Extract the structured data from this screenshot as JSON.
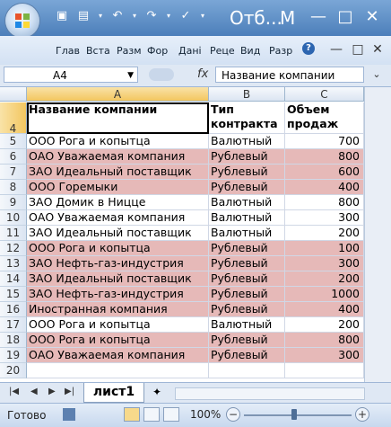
{
  "window": {
    "title": "Отб...",
    "title_extra": "M",
    "controls": [
      "—",
      "□",
      "✕"
    ],
    "quick_access": [
      "save-icon",
      "print-preview-icon",
      "undo-icon",
      "redo-icon",
      "check-icon"
    ]
  },
  "ribbon": {
    "tabs": [
      "Глав",
      "Вста",
      "Разм",
      "Фор",
      "Дані",
      "Реце",
      "Вид",
      "Разр"
    ],
    "help_label": "?"
  },
  "formula_bar": {
    "name_box": "A4",
    "fx_label": "fx",
    "content": "Название компании"
  },
  "columns": [
    "A",
    "B",
    "C"
  ],
  "header_row": {
    "row": "4",
    "cells": [
      "Название компании",
      "Тип контракта",
      "Объем продаж"
    ]
  },
  "rows": [
    {
      "row": "5",
      "company": "ООО Рога и копытца",
      "type": "Валютный",
      "volume": "700",
      "highlight": false
    },
    {
      "row": "6",
      "company": "ОАО Уважаемая компания",
      "type": "Рублевый",
      "volume": "800",
      "highlight": true
    },
    {
      "row": "7",
      "company": "ЗАО Идеальный поставщик",
      "type": "Рублевый",
      "volume": "600",
      "highlight": true
    },
    {
      "row": "8",
      "company": "ООО Горемыки",
      "type": "Рублевый",
      "volume": "400",
      "highlight": true
    },
    {
      "row": "9",
      "company": "ЗАО Домик в Ницце",
      "type": "Валютный",
      "volume": "800",
      "highlight": false
    },
    {
      "row": "10",
      "company": "ОАО Уважаемая компания",
      "type": "Валютный",
      "volume": "300",
      "highlight": false
    },
    {
      "row": "11",
      "company": "ЗАО Идеальный поставщик",
      "type": "Валютный",
      "volume": "200",
      "highlight": false
    },
    {
      "row": "12",
      "company": "ООО Рога и копытца",
      "type": "Рублевый",
      "volume": "100",
      "highlight": true
    },
    {
      "row": "13",
      "company": "ЗАО Нефть-газ-индустрия",
      "type": "Рублевый",
      "volume": "300",
      "highlight": true
    },
    {
      "row": "14",
      "company": "ЗАО Идеальный поставщик",
      "type": "Рублевый",
      "volume": "200",
      "highlight": true
    },
    {
      "row": "15",
      "company": "ЗАО Нефть-газ-индустрия",
      "type": "Рублевый",
      "volume": "1000",
      "highlight": true
    },
    {
      "row": "16",
      "company": "Иностранная компания",
      "type": "Рублевый",
      "volume": "400",
      "highlight": true
    },
    {
      "row": "17",
      "company": "ООО Рога и копытца",
      "type": "Валютный",
      "volume": "200",
      "highlight": false
    },
    {
      "row": "18",
      "company": "ООО Рога и копытца",
      "type": "Рублевый",
      "volume": "800",
      "highlight": true
    },
    {
      "row": "19",
      "company": "ОАО Уважаемая компания",
      "type": "Рублевый",
      "volume": "300",
      "highlight": true
    },
    {
      "row": "20",
      "company": "",
      "type": "",
      "volume": "",
      "highlight": false
    }
  ],
  "sheet_tabs": {
    "active": "лист1"
  },
  "status": {
    "text": "Готово",
    "zoom": "100%",
    "zoom_minus": "−",
    "zoom_plus": "+"
  },
  "colors": {
    "highlight": "#e6b9b8",
    "title_bar": "#4c7fba"
  }
}
